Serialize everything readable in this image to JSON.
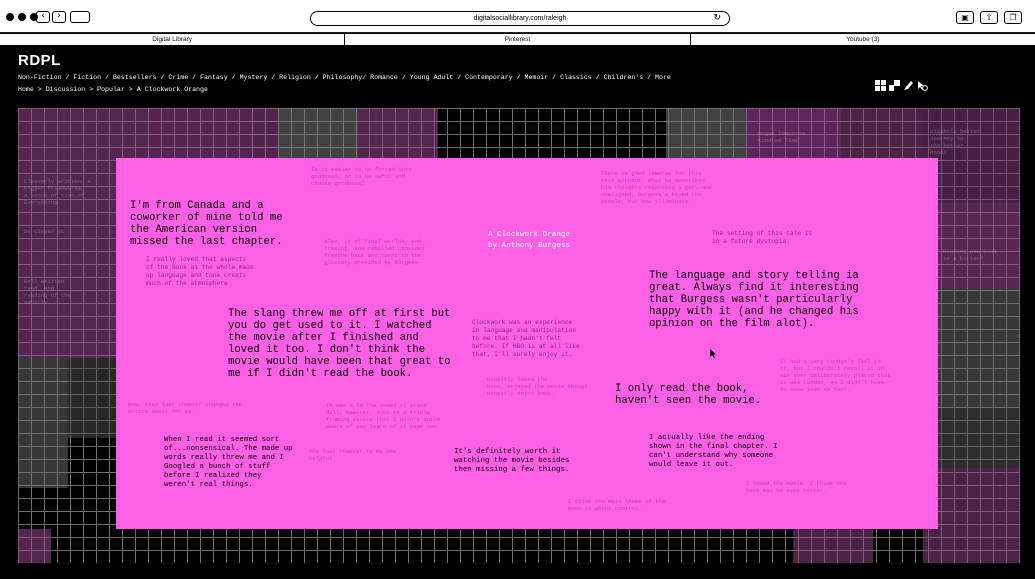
{
  "browser": {
    "url": "digitalsociallibrary.com/raleigh",
    "back_icon": "chevron-left",
    "forward_icon": "chevron-right",
    "tabs": [
      "Digital Library",
      "Pinterest",
      "Youtube (3)"
    ]
  },
  "site": {
    "logo": "RDPL",
    "genres": "Non-Fiction / Fiction / Bestsellers / Crime / Fantasy / Mystery / Religion / Philosophy/ Romance / Young Adult / Contemporary / Memoir / Classics / Children's / More",
    "breadcrumb": "Home > Discussion > Popular > A Clockwork Orange"
  },
  "book": {
    "title_line1": "A Clockwork Orange",
    "title_line2": "by Anthony Burgess",
    "setting": "The setting of this tale is\nin a future dystopia."
  },
  "comments": {
    "c1": "I'm from Canada and a\ncoworker of mine told me\nthe American version\nmissed the last chapter.",
    "c2": "I really loved that aspects\nof the Book as the whole made\nup language and tone creats\nmuch of the atmosphere",
    "c3": "The slang threw me off at first but\nyou do get used to it. I watched\nthe movie after I finished and\nloved it too. I don't think the\nmovie would have been that great to\nme if I didn't read the book.",
    "c4": "Clockwork was an experience\nin language and manipulation\nto me that I hadn't felt\nbefore. If HBO is at all like\nthat, I'll surely enjoy it.",
    "c5": "The language and story telling ia\ngreat. Always find it interesting\nthat Burgess wasn't particularly\nhappy with it (and he changed his\nopinion on the film alot).",
    "c6": "I only read the book,\nhaven't seen the movie.",
    "c7": "When I read it seemed sort\nof...nonsensical. The made up\nwords really threw me and I\nGoogled a bunch of stuff\nbefore I realized they\nweren't real things.",
    "c8": "It's definitely worth it\nwatching the movie besides\nthen missing a few things.",
    "c9": "I actually like the ending\nshown in the final chapter. I\ncan't understand why someone\nwould leave it out."
  },
  "colors": {
    "panel": "#ff60e6",
    "background": "#000000",
    "grid": "#6f6f6f"
  }
}
